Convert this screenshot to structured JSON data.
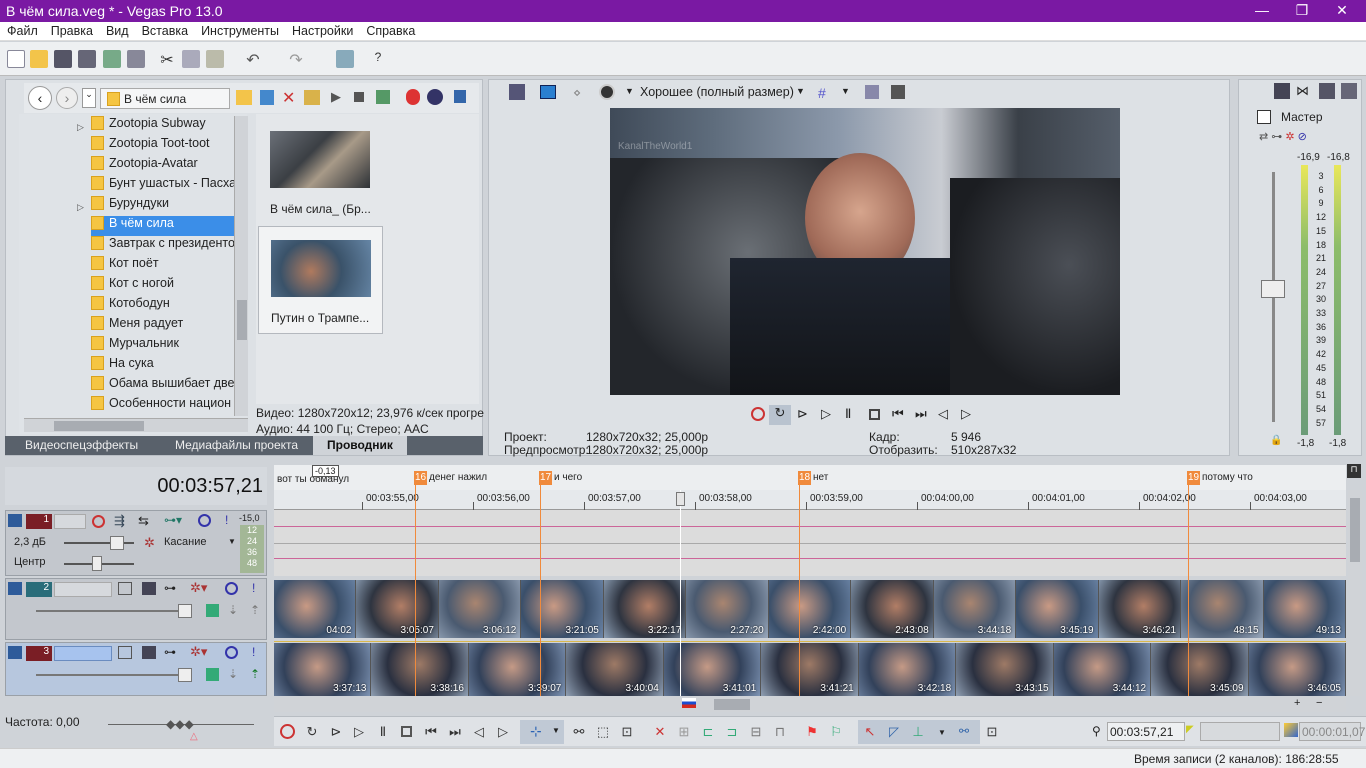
{
  "window": {
    "title": "В чём сила.veg * - Vegas Pro 13.0",
    "min": "—",
    "max": "❐",
    "close": "✕"
  },
  "menu": [
    "Файл",
    "Правка",
    "Вид",
    "Вставка",
    "Инструменты",
    "Настройки",
    "Справка"
  ],
  "explorer": {
    "path": "В чём сила",
    "folders": [
      "Zootopia Subway",
      "Zootopia Toot-toot",
      "Zootopia-Avatar",
      "Бунт ушастых - Пасха",
      "Бурундуки",
      "В чём сила",
      "Завтрак с президентом",
      "Кот поёт",
      "Кот с ногой",
      "Котободун",
      "Меня радует",
      "Мурчальник",
      "На сука",
      "Обама вышибает двер",
      "Особенности национ"
    ],
    "selected_folder": "В чём сила",
    "files": [
      {
        "name": "В чём сила_ (Бр..."
      },
      {
        "name": "Путин о Трампе..."
      }
    ],
    "info_video": "Видео: 1280x720x12; 23,976 к/сек прогре",
    "info_audio": "Аудио: 44 100 Гц; Стерео; AAC",
    "tabs": [
      "Видеоспецэффекты",
      "Медиафайлы проекта",
      "Проводник"
    ]
  },
  "preview": {
    "quality": "Хорошее (полный размер)",
    "watermark": "KanalTheWorld1",
    "project_label": "Проект:",
    "project_value": "1280x720x32; 25,000p",
    "preview_label": "Предпросмотр:",
    "preview_value": "1280x720x32; 25,000p",
    "frame_label": "Кадр:",
    "frame_value": "5 946",
    "display_label": "Отобразить:",
    "display_value": "510x287x32"
  },
  "mixer": {
    "title": "Мастер",
    "left_level": "-16,9",
    "right_level": "-16,8",
    "scale": [
      "3",
      "6",
      "9",
      "12",
      "15",
      "18",
      "21",
      "24",
      "27",
      "30",
      "33",
      "36",
      "39",
      "42",
      "45",
      "48",
      "51",
      "54",
      "57"
    ],
    "bottom_left": "-1,8",
    "bottom_right": "-1,8"
  },
  "timeline": {
    "time": "00:03:57,21",
    "offset": "-0,13",
    "ruler_ticks": [
      "00:03:55,00",
      "00:03:56,00",
      "00:03:57,00",
      "00:03:58,00",
      "00:03:59,00",
      "00:04:00,00",
      "00:04:01,00",
      "00:04:02,00",
      "00:04:03,00"
    ],
    "markers": [
      {
        "n": "16",
        "label": "денег нажил"
      },
      {
        "n": "17",
        "label": "и чего"
      },
      {
        "n": "18",
        "label": "нет"
      },
      {
        "n": "19",
        "label": "потому что"
      }
    ],
    "first_label": "вот ты обманул",
    "track1": {
      "num": "1",
      "db": "2,3 дБ",
      "pan": "Центр",
      "mode": "Касание",
      "meter_top": "-15,0",
      "meter": [
        "12",
        "24",
        "36",
        "48"
      ]
    },
    "track2": {
      "num": "2",
      "codes": [
        "04:02",
        "3:05:07",
        "3:06:12",
        "3:21:05",
        "3:22:17",
        "2:27:20",
        "2:42:00",
        "2:43:08",
        "3:44:18",
        "3:45:19",
        "3:46:21",
        "48:15",
        "49:13"
      ]
    },
    "track3": {
      "num": "3",
      "codes": [
        "3:37:13",
        "3:38:16",
        "3:39:07",
        "3:40:04",
        "3:41:01",
        "3:41:21",
        "3:42:18",
        "3:43:15",
        "3:44:12",
        "3:45:09",
        "3:46:05"
      ]
    }
  },
  "transport": {
    "rate": "Частота: 0,00",
    "cursor_time": "00:03:57,21",
    "length_time": "00:00:01,07"
  },
  "statusbar": {
    "record_time": "Время записи (2 каналов): 186:28:55"
  },
  "colors": {
    "titlebar": "#7a19a3",
    "marker": "#f08a3c",
    "selection": "#3b8ee8"
  }
}
